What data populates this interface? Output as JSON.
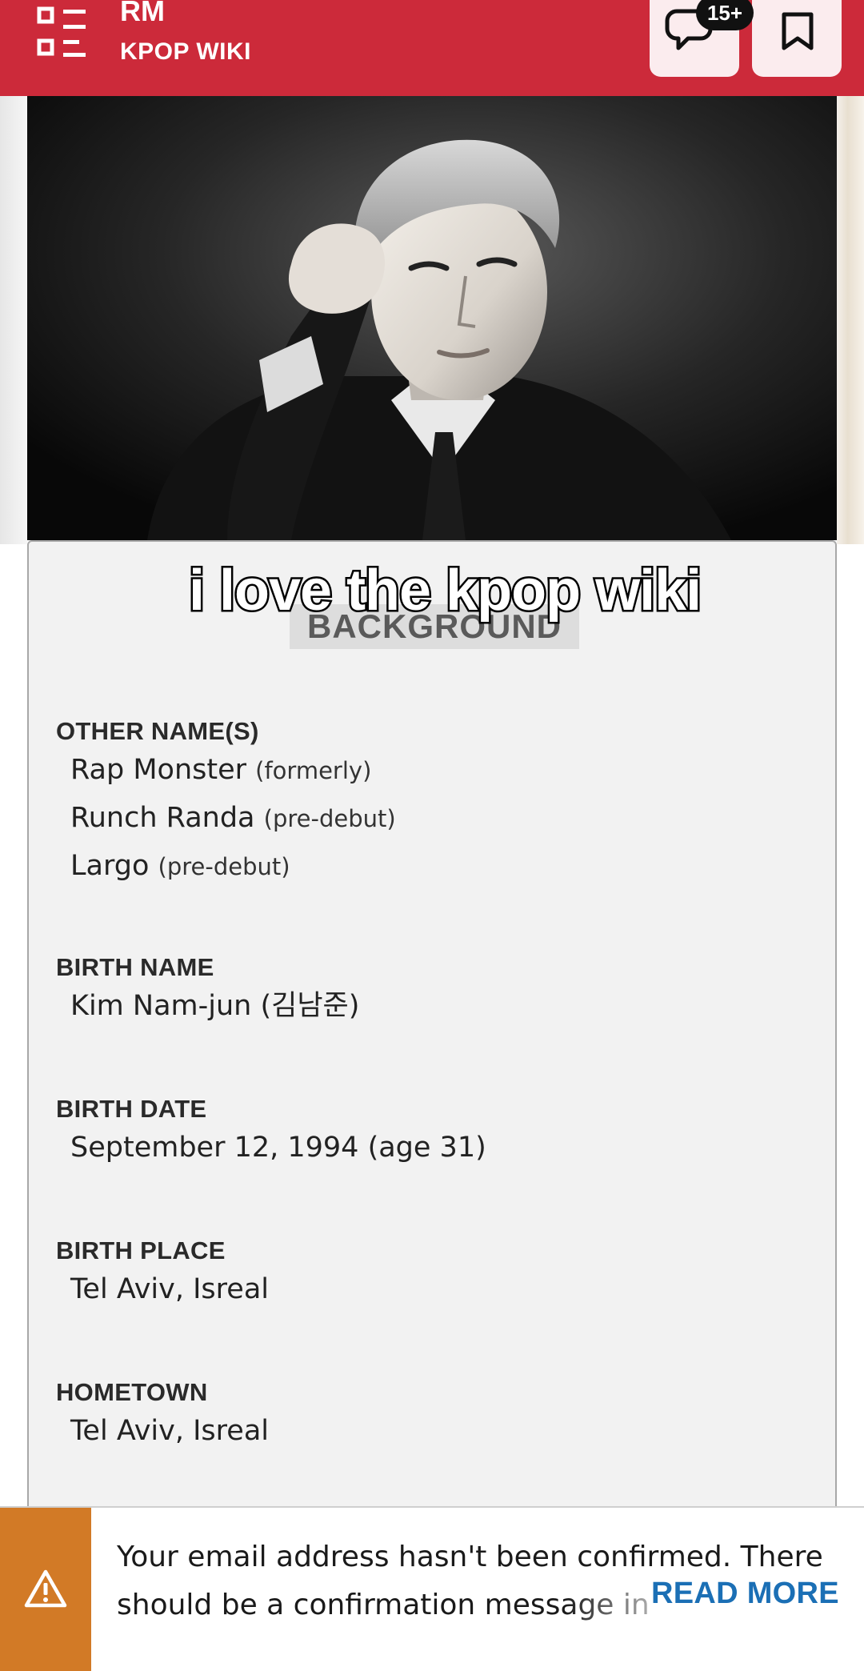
{
  "header": {
    "title": "RM",
    "subtitle": "KPOP WIKI",
    "comment_badge": "15+",
    "icons": {
      "menu": "list-menu-icon",
      "comments": "speech-bubble-icon",
      "bookmark": "bookmark-icon"
    }
  },
  "infobox": {
    "overlay_caption": "i love the kpop wiki",
    "section_heading": "BACKGROUND",
    "other_names": {
      "label": "OTHER NAME(S)",
      "items": [
        {
          "name": "Rap Monster",
          "note": "(formerly)"
        },
        {
          "name": "Runch Randa",
          "note": "(pre-debut)"
        },
        {
          "name": "Largo",
          "note": "(pre-debut)"
        }
      ]
    },
    "birth_name": {
      "label": "BIRTH NAME",
      "value": "Kim Nam-jun (김남준)"
    },
    "birth_date": {
      "label": "BIRTH DATE",
      "value": "September 12, 1994 (age 31)"
    },
    "birth_place": {
      "label": "BIRTH PLACE",
      "value": "Tel Aviv, Isreal"
    },
    "hometown": {
      "label": "HOMETOWN",
      "value": "Tel Aviv, Isreal"
    }
  },
  "notice": {
    "icon": "warning-triangle-icon",
    "line1": "Your email address hasn't been confirmed. There",
    "line2": "should be a confirmation message in",
    "read_more": "READ MORE"
  },
  "colors": {
    "header_bg": "#cc2a3a",
    "notice_icon_bg": "#d27a26",
    "link": "#1b6fb5",
    "panel_bg": "#f2f2f2"
  }
}
